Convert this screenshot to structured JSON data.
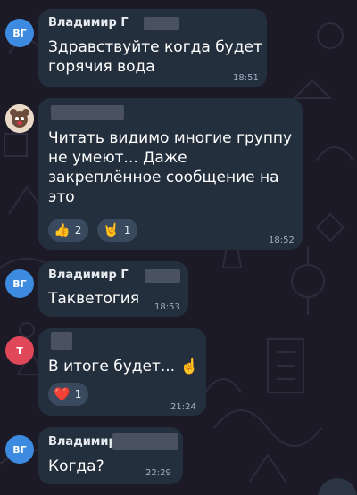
{
  "chat": {
    "messages": [
      {
        "avatar_initials": "ВГ",
        "sender": "Владимир Г",
        "text_lines": [
          "Здравствуйте когда будет",
          "горячия вода"
        ],
        "time": "18:51"
      },
      {
        "avatar_icon": "user-photo-avatar",
        "sender": "",
        "text_lines": [
          "Читать видимо многие группу",
          "не умеют... Даже",
          "закреплённое сообщение на",
          "это"
        ],
        "reactions": [
          {
            "emoji": "👍",
            "count": "2"
          },
          {
            "emoji": "🤘",
            "count": "1"
          }
        ],
        "time": "18:52"
      },
      {
        "avatar_initials": "ВГ",
        "sender": "Владимир Г",
        "text_lines": [
          "Такветогия"
        ],
        "time": "18:53"
      },
      {
        "avatar_initials": "Т",
        "sender": "",
        "text_lines": [
          "В итоге будет... ☝️"
        ],
        "reactions": [
          {
            "emoji": "❤️",
            "count": "1"
          }
        ],
        "time": "21:24"
      },
      {
        "avatar_initials": "ВГ",
        "sender": "Владимир",
        "text_lines": [
          "Когда?"
        ],
        "time": "22:29"
      }
    ]
  },
  "colors": {
    "background": "#1b1a26",
    "bubble": "#242f3d",
    "avatar_blue": "#3d8be0",
    "avatar_red": "#e0485a"
  }
}
